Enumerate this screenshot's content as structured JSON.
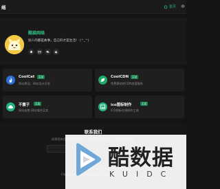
{
  "header": {
    "site_title": "络",
    "home_label": "首页",
    "icons": [
      "home-icon",
      "gear-icon"
    ]
  },
  "profile": {
    "username": "酷猫网络",
    "bio": "别人的都是故事，自己的才是生活！ (^_^)",
    "socials": [
      "qq-icon",
      "mail-icon",
      "wechat-icon",
      "users-icon"
    ]
  },
  "cards": [
    {
      "title": "CoolCat",
      "badge": "主站",
      "desc": "网站建设，网站设计开发",
      "icon": "flame-icon",
      "icon_color": "#2e6fd6"
    },
    {
      "title": "CoolCDN",
      "badge": "主站",
      "desc": "免费建站的CDN加速服务",
      "icon": "leaf-icon",
      "icon_color": "#22a968"
    },
    {
      "title": "不露子",
      "badge": "主站",
      "desc": "网站出售 网站域名买卖",
      "icon": "cloud-icon",
      "icon_color": "#27b27e"
    },
    {
      "title": "ico图标制作",
      "badge": "主站",
      "desc": "ICO图标在线制作工具",
      "icon": "image-icon",
      "icon_color": "#27b27e"
    }
  ],
  "contact": {
    "title": "联系我们",
    "desc": "如果您有任何问题或建议 请发送邮件到 邮箱我们 会尽快回复处理",
    "icp": "粤ICP备19000032号-3",
    "copyright": "Copyright © 2020 酷猫网络 All rights reserved."
  },
  "watermark": {
    "main": "酷数据",
    "sub": "KUIDC"
  }
}
